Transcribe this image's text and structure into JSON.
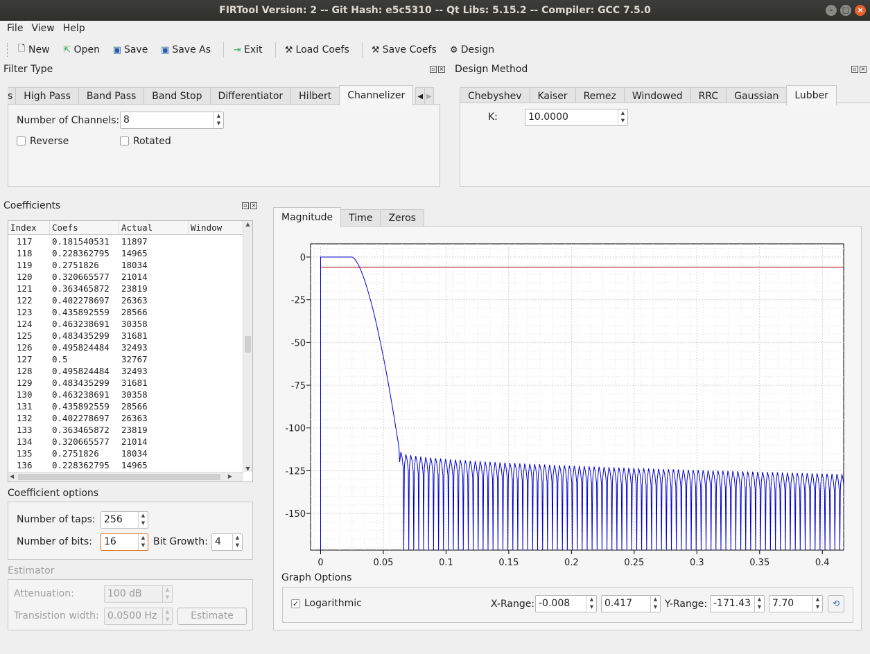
{
  "window": {
    "title": "FIRTool Version: 2 -- Git Hash: e5c5310 -- Qt Libs: 5.15.2 -- Compiler: GCC 7.5.0"
  },
  "menu": [
    "File",
    "View",
    "Help"
  ],
  "toolbar": {
    "new": "New",
    "open": "Open",
    "save": "Save",
    "save_as": "Save As",
    "exit": "Exit",
    "load_coefs": "Load Coefs",
    "save_coefs": "Save Coefs",
    "design": "Design"
  },
  "filter_type": {
    "title": "Filter Type",
    "tabs": [
      "s",
      "High Pass",
      "Band Pass",
      "Band Stop",
      "Differentiator",
      "Hilbert",
      "Channelizer"
    ],
    "active": "Channelizer",
    "channels_label": "Number of Channels:",
    "channels_value": "8",
    "reverse_label": "Reverse",
    "rotated_label": "Rotated"
  },
  "design_method": {
    "title": "Design Method",
    "tabs": [
      "Chebyshev",
      "Kaiser",
      "Remez",
      "Windowed",
      "RRC",
      "Gaussian",
      "Lubber"
    ],
    "active": "Lubber",
    "k_label": "K:",
    "k_value": "10.0000"
  },
  "coefficients": {
    "title": "Coefficients",
    "columns": [
      "Index",
      "Coefs",
      "Actual",
      "Window"
    ],
    "rows": [
      [
        "117",
        "0.181540531",
        "11897"
      ],
      [
        "118",
        "0.228362795",
        "14965"
      ],
      [
        "119",
        "0.2751826",
        "18034"
      ],
      [
        "120",
        "0.320665577",
        "21014"
      ],
      [
        "121",
        "0.363465872",
        "23819"
      ],
      [
        "122",
        "0.402278697",
        "26363"
      ],
      [
        "123",
        "0.435892559",
        "28566"
      ],
      [
        "124",
        "0.463238691",
        "30358"
      ],
      [
        "125",
        "0.483435299",
        "31681"
      ],
      [
        "126",
        "0.495824484",
        "32493"
      ],
      [
        "127",
        "0.5",
        "32767"
      ],
      [
        "128",
        "0.495824484",
        "32493"
      ],
      [
        "129",
        "0.483435299",
        "31681"
      ],
      [
        "130",
        "0.463238691",
        "30358"
      ],
      [
        "131",
        "0.435892559",
        "28566"
      ],
      [
        "132",
        "0.402278697",
        "26363"
      ],
      [
        "133",
        "0.363465872",
        "23819"
      ],
      [
        "134",
        "0.320665577",
        "21014"
      ],
      [
        "135",
        "0.2751826",
        "18034"
      ],
      [
        "136",
        "0.228362795",
        "14965"
      ]
    ]
  },
  "coef_options": {
    "title": "Coefficient options",
    "taps_label": "Number of taps:",
    "taps_value": "256",
    "bits_label": "Number of bits:",
    "bits_value": "16",
    "growth_label": "Bit Growth:",
    "growth_value": "4"
  },
  "estimator": {
    "title": "Estimator",
    "atten_label": "Attenuation:",
    "atten_value": "100 dB",
    "tw_label": "Transistion width:",
    "tw_value": "0.0500 Hz",
    "button": "Estimate"
  },
  "plot_tabs": [
    "Magnitude",
    "Time",
    "Zeros"
  ],
  "graph_options": {
    "title": "Graph Options",
    "log_label": "Logarithmic",
    "log_checked": true,
    "xrange_label": "X-Range:",
    "xmin": "-0.008",
    "xmax": "0.417",
    "yrange_label": "Y-Range:",
    "ymin": "-171.43",
    "ymax": "7.70"
  },
  "chart_data": {
    "type": "line",
    "xlim": [
      -0.008,
      0.417
    ],
    "ylim": [
      -171.43,
      7.7
    ],
    "xticks": [
      "0",
      "0.05",
      "0.1",
      "0.15",
      "0.2",
      "0.25",
      "0.3",
      "0.35",
      "0.4"
    ],
    "xtick_values": [
      0,
      0.05,
      0.1,
      0.15,
      0.2,
      0.25,
      0.3,
      0.35,
      0.4
    ],
    "yticks": [
      "0",
      "-25",
      "-50",
      "-75",
      "-100",
      "-125",
      "-150"
    ],
    "ytick_values": [
      0,
      -25,
      -50,
      -75,
      -100,
      -125,
      -150
    ],
    "reference_line_y": -6,
    "passband_edge": 0.025,
    "stopband_start": 0.063,
    "sidelobe_level_start": -114,
    "sidelobe_level_end": -127,
    "grid": true,
    "line_color": "#0000cc",
    "ref_color": "#aa0000"
  }
}
